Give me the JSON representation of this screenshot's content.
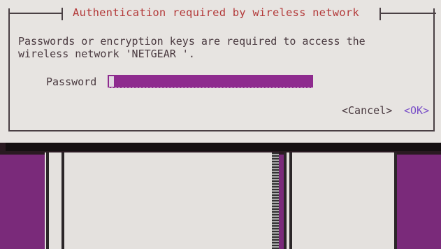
{
  "dialog": {
    "title": "Authentication required by wireless network",
    "message_line1": "Passwords or encryption keys are required to access the",
    "message_line2": "wireless network 'NETGEAR '.",
    "password_label": "Password",
    "password_value": "",
    "cancel_label": "<Cancel>",
    "ok_label": "<OK>"
  },
  "colors": {
    "desktop_bg": "#7a2a7a",
    "dialog_bg": "#e7e4e1",
    "title_text": "#b33a3a",
    "input_bg": "#8e2b8e",
    "ok_text": "#7a50c8"
  }
}
